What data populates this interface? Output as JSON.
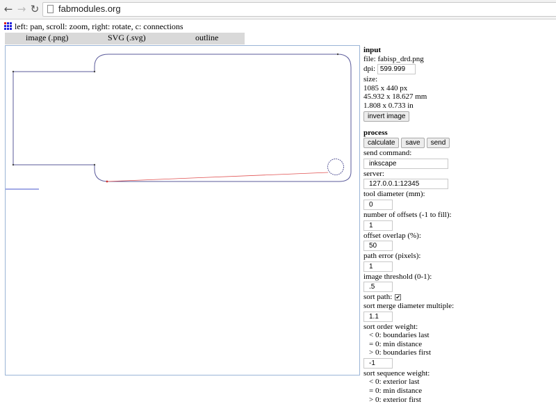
{
  "browser": {
    "url": "fabmodules.org",
    "back_icon": "back-arrow-icon",
    "forward_icon": "forward-arrow-icon",
    "reload_icon": "reload-icon"
  },
  "header": {
    "instructions": "left: pan, scroll: zoom, right: rotate, c: connections",
    "menu": [
      "image (.png)",
      "SVG (.svg)",
      "outline"
    ]
  },
  "panel": {
    "input": {
      "title": "input",
      "file": "file: fabisp_drd.png",
      "dpi_label": "dpi:",
      "dpi_value": "599.999",
      "size_label": "size:",
      "size_px": "1085 x 440 px",
      "size_mm": "45.932 x 18.627 mm",
      "size_in": "1.808 x 0.733 in",
      "invert_button": "invert image"
    },
    "process": {
      "title": "process",
      "buttons": [
        "calculate",
        "save",
        "send"
      ],
      "send_command_label": "send command:",
      "send_command_value": "inkscape",
      "server_label": "server:",
      "server_value": "127.0.0.1:12345",
      "tool_diameter_label": "tool diameter (mm):",
      "tool_diameter_value": "0",
      "offsets_label": "number of offsets (-1 to fill):",
      "offsets_value": "1",
      "overlap_label": "offset overlap (%):",
      "overlap_value": "50",
      "path_error_label": "path error (pixels):",
      "path_error_value": "1",
      "threshold_label": "image threshold (0-1):",
      "threshold_value": ".5",
      "sort_path_label": "sort path:",
      "sort_path_checked": "✔",
      "merge_label": "sort merge diameter multiple:",
      "merge_value": "1.1",
      "order_label": "sort order weight:",
      "order_lines": [
        "< 0: boundaries last",
        "= 0: min distance",
        "> 0: boundaries first"
      ],
      "order_value": "-1",
      "sequence_label": "sort sequence weight:",
      "sequence_lines": [
        "< 0: exterior last",
        "= 0: min distance",
        "> 0: exterior first"
      ]
    }
  },
  "colors": {
    "path": "#5a5a9a",
    "connection": "#e05050",
    "menu_bg": "#d9d9d9"
  }
}
